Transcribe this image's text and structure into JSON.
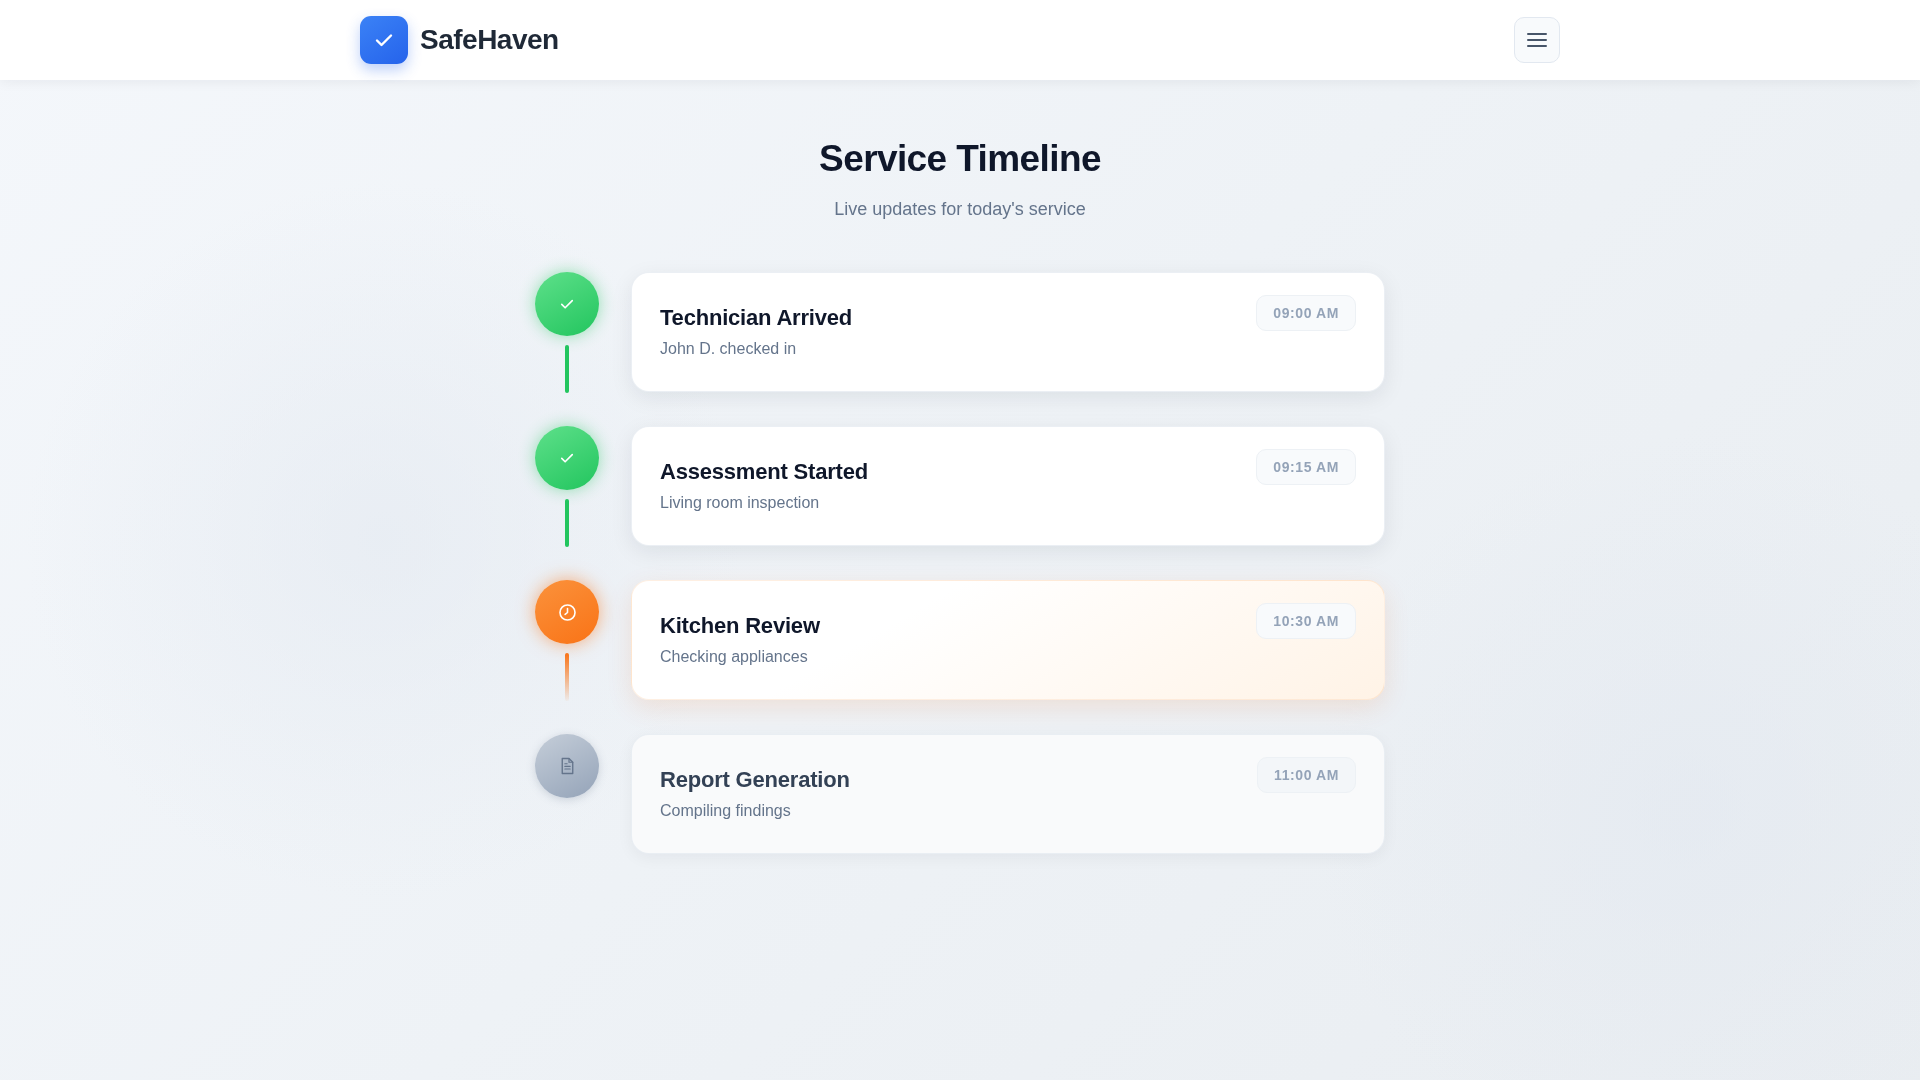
{
  "header": {
    "brand": "SafeHaven"
  },
  "page": {
    "title": "Service Timeline",
    "subtitle": "Live updates for today's service"
  },
  "timeline": [
    {
      "kind": "completed",
      "title": "Technician Arrived",
      "description": "John D. checked in",
      "time": "09:00 AM"
    },
    {
      "kind": "completed",
      "title": "Assessment Started",
      "description": "Living room inspection",
      "time": "09:15 AM"
    },
    {
      "kind": "current",
      "title": "Kitchen Review",
      "description": "Checking appliances",
      "time": "10:30 AM"
    },
    {
      "kind": "pending",
      "title": "Report Generation",
      "description": "Compiling findings",
      "time": "11:00 AM"
    }
  ]
}
